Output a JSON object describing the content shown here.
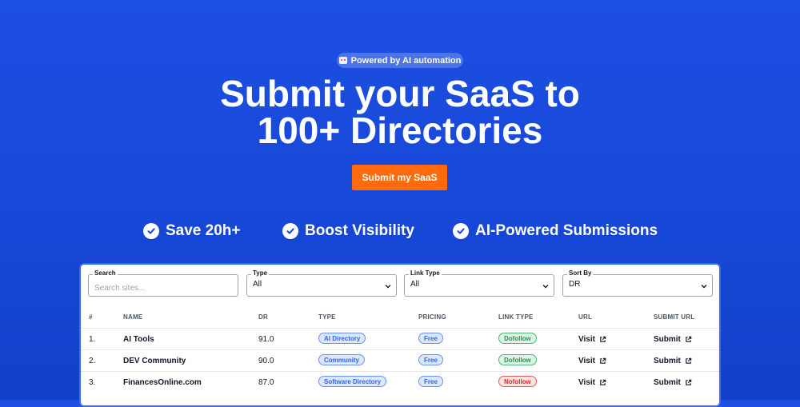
{
  "hero": {
    "badge": "Powered by AI automation",
    "title_line1": "Submit your SaaS to",
    "title_line2": "100+ Directories",
    "cta": "Submit my SaaS"
  },
  "benefits": [
    "Save 20h+",
    "Boost Visibility",
    "AI-Powered Submissions"
  ],
  "filters": {
    "search": {
      "label": "Search",
      "placeholder": "Search sites..."
    },
    "type": {
      "label": "Type",
      "value": "All"
    },
    "link_type": {
      "label": "Link Type",
      "value": "All"
    },
    "sort_by": {
      "label": "Sort By",
      "value": "DR"
    }
  },
  "table": {
    "headers": [
      "#",
      "NAME",
      "DR",
      "TYPE",
      "PRICING",
      "LINK TYPE",
      "URL",
      "SUBMIT URL"
    ],
    "rows": [
      {
        "num": "1.",
        "name": "AI Tools",
        "dr": "91.0",
        "type": "AI Directory",
        "pricing": "Free",
        "link_type": "Dofollow",
        "link_color": "green",
        "url": "Visit",
        "submit": "Submit"
      },
      {
        "num": "2.",
        "name": "DEV Community",
        "dr": "90.0",
        "type": "Community",
        "pricing": "Free",
        "link_type": "Dofollow",
        "link_color": "green",
        "url": "Visit",
        "submit": "Submit"
      },
      {
        "num": "3.",
        "name": "FinancesOnline.com",
        "dr": "87.0",
        "type": "Software Directory",
        "pricing": "Free",
        "link_type": "Nofollow",
        "link_color": "red",
        "url": "Visit",
        "submit": "Submit"
      }
    ]
  },
  "colors": {
    "accent": "#ff6a0c",
    "background": "#1747d6"
  }
}
